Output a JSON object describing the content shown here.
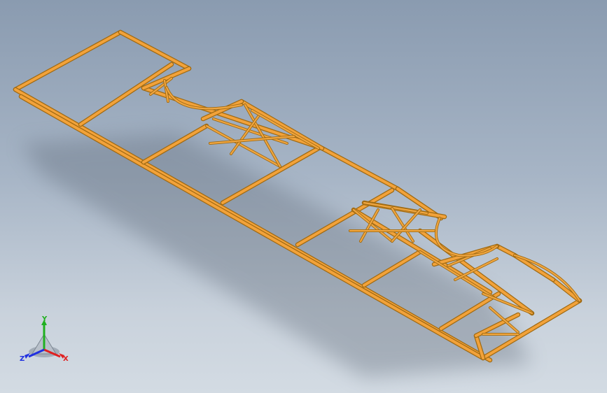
{
  "viewport": {
    "background_top": "#8a9bb0",
    "background_bottom": "#d3dbe3"
  },
  "model": {
    "frame_color": "#f2a23a",
    "frame_edge_color": "#a06a12"
  },
  "triad": {
    "x_label": "X",
    "y_label": "Y",
    "z_label": "Z",
    "x_color": "#e02020",
    "y_color": "#20b020",
    "z_color": "#2030e0"
  }
}
